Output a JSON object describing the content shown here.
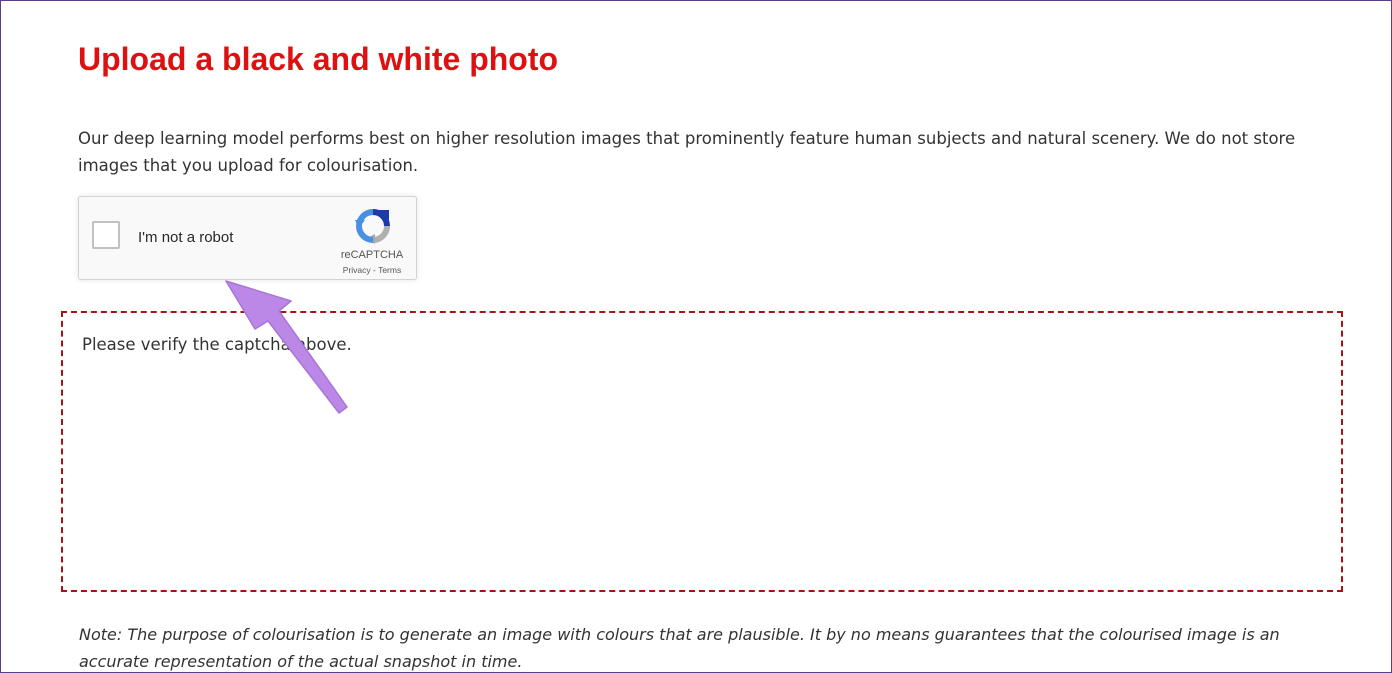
{
  "header": {
    "title": "Upload a black and white photo"
  },
  "intro": {
    "text": "Our deep learning model performs best on higher resolution images that prominently feature human subjects and natural scenery. We do not store images that you upload for colourisation."
  },
  "captcha": {
    "label": "I'm not a robot",
    "brand": "reCAPTCHA",
    "privacy": "Privacy",
    "separator": " - ",
    "terms": "Terms",
    "checked": false
  },
  "dropzone": {
    "message": "Please verify the captcha above."
  },
  "note": {
    "text": "Note: The purpose of colourisation is to generate an image with colours that are plausible. It by no means guarantees that the colourised image is an accurate representation of the actual snapshot in time."
  },
  "colors": {
    "title": "#dd1111",
    "dropzone_border": "#a31515",
    "annotation_arrow": "#bb88e8"
  }
}
